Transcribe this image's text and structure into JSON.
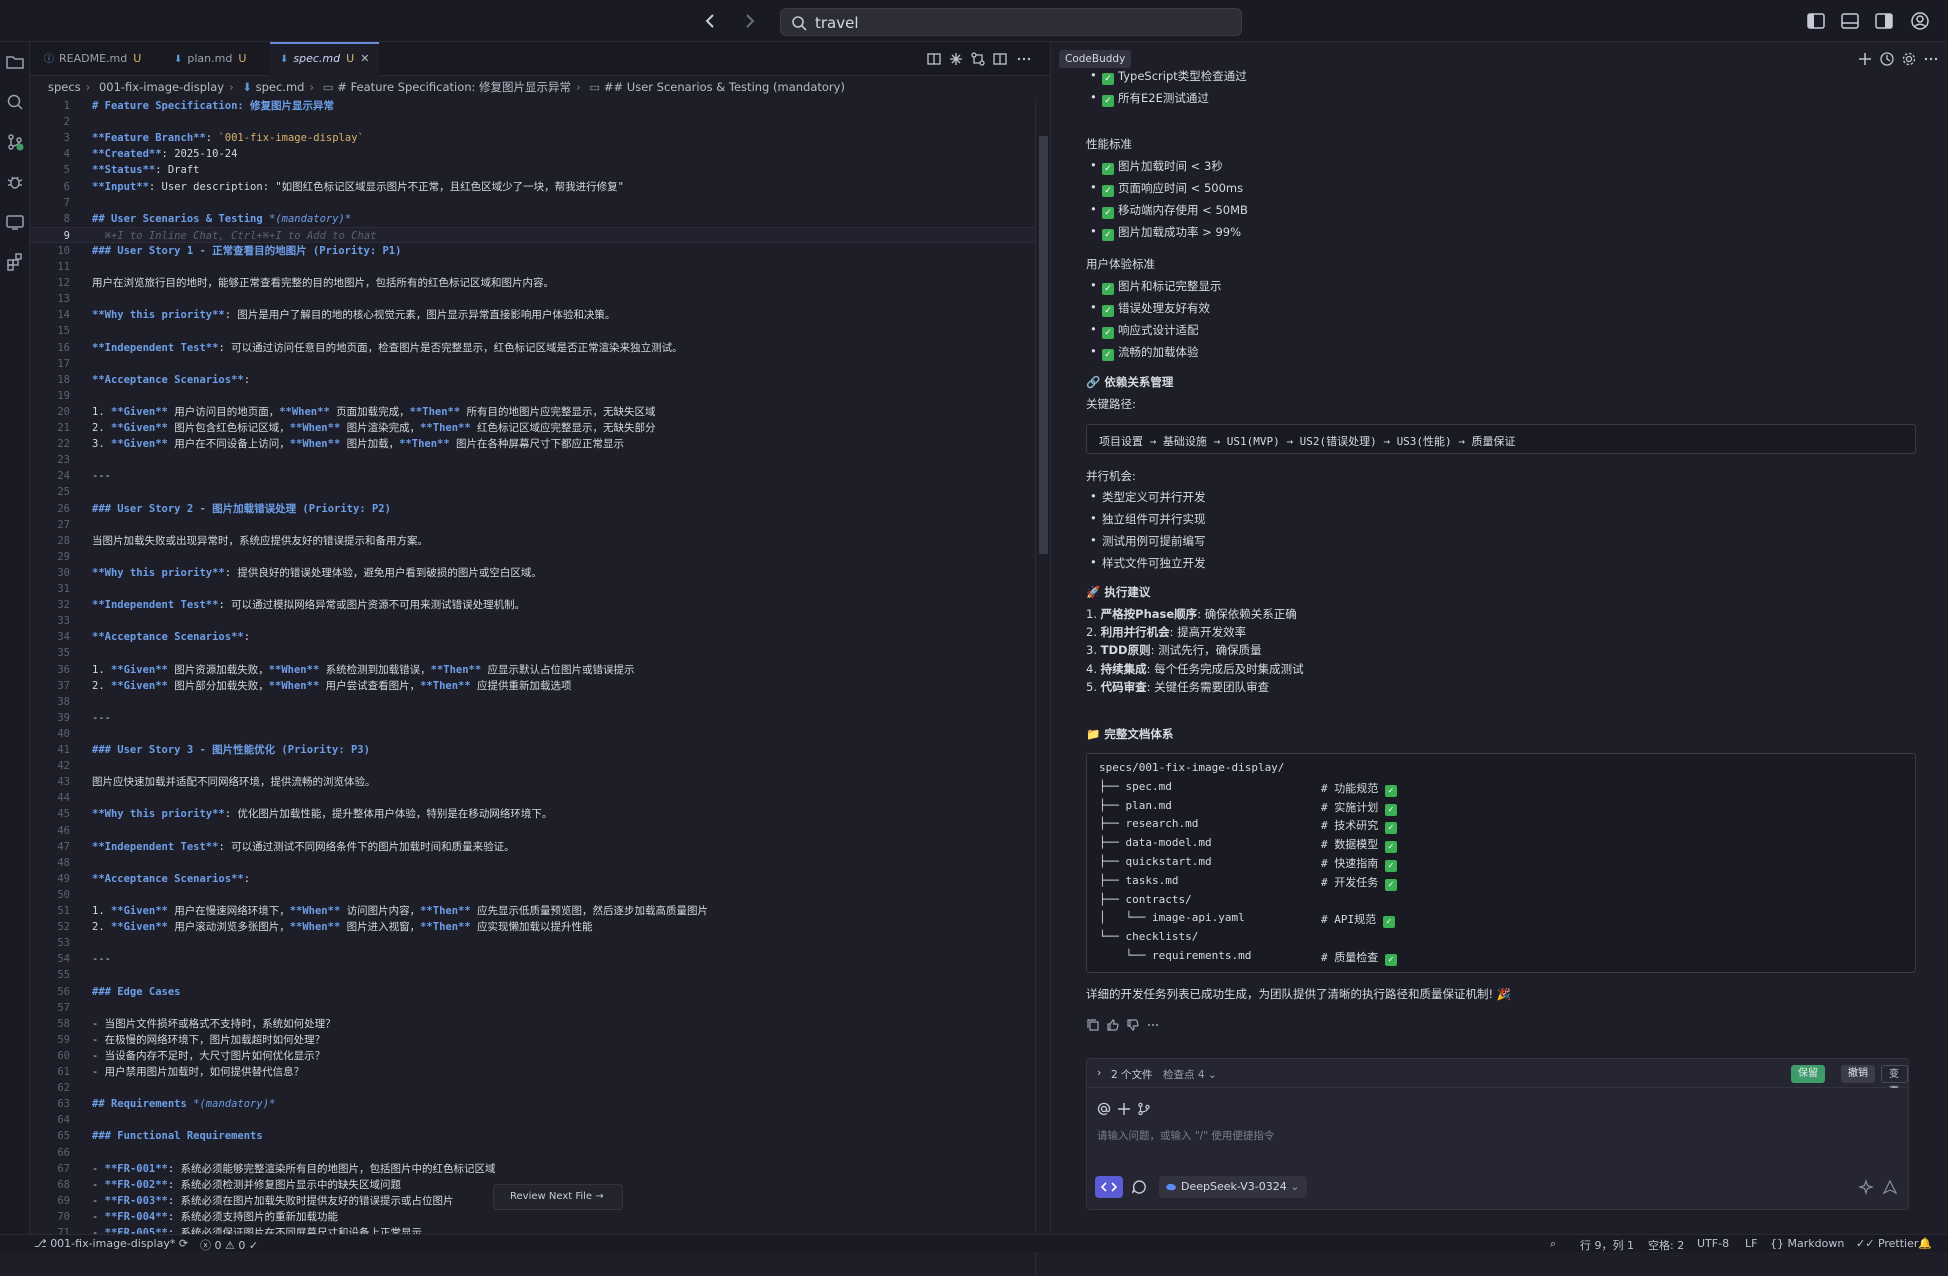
{
  "search": {
    "value": "travel"
  },
  "tabs": [
    {
      "label": "README.md",
      "status": "U"
    },
    {
      "label": "plan.md",
      "status": "U"
    },
    {
      "label": "spec.md",
      "status": "U"
    }
  ],
  "breadcrumb": [
    "specs",
    "001-fix-image-display",
    "spec.md",
    "# Feature Specification: 修复图片显示异常",
    "## User Scenarios & Testing (mandatory)"
  ],
  "editor": {
    "lines": [
      [
        {
          "t": "# Feature Specification: 修复图片显示异常",
          "c": "h"
        }
      ],
      [],
      [
        {
          "t": "**Feature Branch**",
          "c": "b"
        },
        {
          "t": ": "
        },
        {
          "t": "`001-fix-image-display`",
          "c": "str"
        }
      ],
      [
        {
          "t": "**Created**",
          "c": "b"
        },
        {
          "t": ": 2025-10-24"
        }
      ],
      [
        {
          "t": "**Status**",
          "c": "b"
        },
        {
          "t": ": Draft"
        }
      ],
      [
        {
          "t": "**Input**",
          "c": "b"
        },
        {
          "t": ": User description: \"如图红色标记区域显示图片不正常，且红色区域少了一块，帮我进行修复\""
        }
      ],
      [],
      [
        {
          "t": "## User Scenarios & Testing ",
          "c": "h"
        },
        {
          "t": "*(mandatory)*",
          "c": "it"
        }
      ],
      [
        {
          "t": "  ⌘+I to Inline Chat, Ctrl+⌘+I to Add to Chat",
          "c": "hint"
        }
      ],
      [
        {
          "t": "### User Story 1 - 正常查看目的地图片 (Priority: P1)",
          "c": "h"
        }
      ],
      [],
      [
        {
          "t": "用户在浏览旅行目的地时，能够正常查看完整的目的地图片，包括所有的红色标记区域和图片内容。"
        }
      ],
      [],
      [
        {
          "t": "**Why this priority**",
          "c": "b"
        },
        {
          "t": ": 图片是用户了解目的地的核心视觉元素，图片显示异常直接影响用户体验和决策。"
        }
      ],
      [],
      [
        {
          "t": "**Independent Test**",
          "c": "b"
        },
        {
          "t": ": 可以通过访问任意目的地页面，检查图片是否完整显示，红色标记区域是否正常渲染来独立测试。"
        }
      ],
      [],
      [
        {
          "t": "**Acceptance Scenarios**",
          "c": "b"
        },
        {
          "t": ":"
        }
      ],
      [],
      [
        {
          "t": "1. "
        },
        {
          "t": "**Given**",
          "c": "b"
        },
        {
          "t": " 用户访问目的地页面，"
        },
        {
          "t": "**When**",
          "c": "b"
        },
        {
          "t": " 页面加载完成，"
        },
        {
          "t": "**Then**",
          "c": "b"
        },
        {
          "t": " 所有目的地图片应完整显示，无缺失区域"
        }
      ],
      [
        {
          "t": "2. "
        },
        {
          "t": "**Given**",
          "c": "b"
        },
        {
          "t": " 图片包含红色标记区域，"
        },
        {
          "t": "**When**",
          "c": "b"
        },
        {
          "t": " 图片渲染完成，"
        },
        {
          "t": "**Then**",
          "c": "b"
        },
        {
          "t": " 红色标记区域应完整显示，无缺失部分"
        }
      ],
      [
        {
          "t": "3. "
        },
        {
          "t": "**Given**",
          "c": "b"
        },
        {
          "t": " 用户在不同设备上访问，"
        },
        {
          "t": "**When**",
          "c": "b"
        },
        {
          "t": " 图片加载，"
        },
        {
          "t": "**Then**",
          "c": "b"
        },
        {
          "t": " 图片在各种屏幕尺寸下都应正常显示"
        }
      ],
      [],
      [
        {
          "t": "---"
        }
      ],
      [],
      [
        {
          "t": "### User Story 2 - 图片加载错误处理 (Priority: P2)",
          "c": "h"
        }
      ],
      [],
      [
        {
          "t": "当图片加载失败或出现异常时，系统应提供友好的错误提示和备用方案。"
        }
      ],
      [],
      [
        {
          "t": "**Why this priority**",
          "c": "b"
        },
        {
          "t": ": 提供良好的错误处理体验，避免用户看到破损的图片或空白区域。"
        }
      ],
      [],
      [
        {
          "t": "**Independent Test**",
          "c": "b"
        },
        {
          "t": ": 可以通过模拟网络异常或图片资源不可用来测试错误处理机制。"
        }
      ],
      [],
      [
        {
          "t": "**Acceptance Scenarios**",
          "c": "b"
        },
        {
          "t": ":"
        }
      ],
      [],
      [
        {
          "t": "1. "
        },
        {
          "t": "**Given**",
          "c": "b"
        },
        {
          "t": " 图片资源加载失败，"
        },
        {
          "t": "**When**",
          "c": "b"
        },
        {
          "t": " 系统检测到加载错误，"
        },
        {
          "t": "**Then**",
          "c": "b"
        },
        {
          "t": " 应显示默认占位图片或错误提示"
        }
      ],
      [
        {
          "t": "2. "
        },
        {
          "t": "**Given**",
          "c": "b"
        },
        {
          "t": " 图片部分加载失败，"
        },
        {
          "t": "**When**",
          "c": "b"
        },
        {
          "t": " 用户尝试查看图片，"
        },
        {
          "t": "**Then**",
          "c": "b"
        },
        {
          "t": " 应提供重新加载选项"
        }
      ],
      [],
      [
        {
          "t": "---"
        }
      ],
      [],
      [
        {
          "t": "### User Story 3 - 图片性能优化 (Priority: P3)",
          "c": "h"
        }
      ],
      [],
      [
        {
          "t": "图片应快速加载并适配不同网络环境，提供流畅的浏览体验。"
        }
      ],
      [],
      [
        {
          "t": "**Why this priority**",
          "c": "b"
        },
        {
          "t": ": 优化图片加载性能，提升整体用户体验，特别是在移动网络环境下。"
        }
      ],
      [],
      [
        {
          "t": "**Independent Test**",
          "c": "b"
        },
        {
          "t": ": 可以通过测试不同网络条件下的图片加载时间和质量来验证。"
        }
      ],
      [],
      [
        {
          "t": "**Acceptance Scenarios**",
          "c": "b"
        },
        {
          "t": ":"
        }
      ],
      [],
      [
        {
          "t": "1. "
        },
        {
          "t": "**Given**",
          "c": "b"
        },
        {
          "t": " 用户在慢速网络环境下，"
        },
        {
          "t": "**When**",
          "c": "b"
        },
        {
          "t": " 访问图片内容，"
        },
        {
          "t": "**Then**",
          "c": "b"
        },
        {
          "t": " 应先显示低质量预览图，然后逐步加载高质量图片"
        }
      ],
      [
        {
          "t": "2. "
        },
        {
          "t": "**Given**",
          "c": "b"
        },
        {
          "t": " 用户滚动浏览多张图片，"
        },
        {
          "t": "**When**",
          "c": "b"
        },
        {
          "t": " 图片进入视窗，"
        },
        {
          "t": "**Then**",
          "c": "b"
        },
        {
          "t": " 应实现懒加载以提升性能"
        }
      ],
      [],
      [
        {
          "t": "---"
        }
      ],
      [],
      [
        {
          "t": "### Edge Cases",
          "c": "h"
        }
      ],
      [],
      [
        {
          "t": "- 当图片文件损坏或格式不支持时，系统如何处理？"
        }
      ],
      [
        {
          "t": "- 在极慢的网络环境下，图片加载超时如何处理？"
        }
      ],
      [
        {
          "t": "- 当设备内存不足时，大尺寸图片如何优化显示？"
        }
      ],
      [
        {
          "t": "- 用户禁用图片加载时，如何提供替代信息？"
        }
      ],
      [],
      [
        {
          "t": "## Requirements ",
          "c": "h"
        },
        {
          "t": "*(mandatory)*",
          "c": "it"
        }
      ],
      [],
      [
        {
          "t": "### Functional Requirements",
          "c": "h"
        }
      ],
      [],
      [
        {
          "t": "- "
        },
        {
          "t": "**FR-001**",
          "c": "b"
        },
        {
          "t": ": 系统必须能够完整渲染所有目的地图片，包括图片中的红色标记区域"
        }
      ],
      [
        {
          "t": "- "
        },
        {
          "t": "**FR-002**",
          "c": "b"
        },
        {
          "t": ": 系统必须检测并修复图片显示中的缺失区域问题"
        }
      ],
      [
        {
          "t": "- "
        },
        {
          "t": "**FR-003**",
          "c": "b"
        },
        {
          "t": ": 系统必须在图片加载失败时提供友好的错误提示或占位图片"
        }
      ],
      [
        {
          "t": "- "
        },
        {
          "t": "**FR-004**",
          "c": "b"
        },
        {
          "t": ": 系统必须支持图片的重新加载功能"
        }
      ],
      [
        {
          "t": "- "
        },
        {
          "t": "**FR-005**",
          "c": "b"
        },
        {
          "t": ": 系统必须保证图片在不同屏幕尺寸和设备上正常显示"
        }
      ]
    ],
    "current_line": 9,
    "review_label": "Review Next File"
  },
  "chat": {
    "badge": "CodeBuddy",
    "top_items": [
      "TypeScript类型检查通过",
      "所有E2E测试通过"
    ],
    "perf_title": "性能标准",
    "perf_items": [
      "图片加载时间 < 3秒",
      "页面响应时间 < 500ms",
      "移动端内存使用 < 50MB",
      "图片加载成功率 > 99%"
    ],
    "ux_title": "用户体验标准",
    "ux_items": [
      "图片和标记完整显示",
      "错误处理友好有效",
      "响应式设计适配",
      "流畅的加载体验"
    ],
    "dep_title": "🔗 依赖关系管理",
    "key_path_label": "关键路径:",
    "key_path": "项目设置 → 基础设施 → US1(MVP) → US2(错误处理) → US3(性能) → 质量保证",
    "parallel_label": "并行机会:",
    "parallel_items": [
      "类型定义可并行开发",
      "独立组件可并行实现",
      "测试用例可提前编写",
      "样式文件可独立开发"
    ],
    "exec_title": "🚀 执行建议",
    "exec_items": [
      {
        "n": "1.",
        "b": "严格按Phase顺序",
        "t": ": 确保依赖关系正确"
      },
      {
        "n": "2.",
        "b": "利用并行机会",
        "t": ": 提高开发效率"
      },
      {
        "n": "3.",
        "b": "TDD原则",
        "t": ": 测试先行，确保质量"
      },
      {
        "n": "4.",
        "b": "持续集成",
        "t": ": 每个任务完成后及时集成测试"
      },
      {
        "n": "5.",
        "b": "代码审查",
        "t": ": 关键任务需要团队审查"
      }
    ],
    "docs_title": "📁 完整文档体系",
    "tree": [
      {
        "p": "specs/001-fix-image-display/",
        "c": ""
      },
      {
        "p": "├── spec.md",
        "c": "# 功能规范"
      },
      {
        "p": "├── plan.md",
        "c": "# 实施计划"
      },
      {
        "p": "├── research.md",
        "c": "# 技术研究"
      },
      {
        "p": "├── data-model.md",
        "c": "# 数据模型"
      },
      {
        "p": "├── quickstart.md",
        "c": "# 快速指南"
      },
      {
        "p": "├── tasks.md",
        "c": "# 开发任务"
      },
      {
        "p": "├── contracts/",
        "c": ""
      },
      {
        "p": "│   └── image-api.yaml",
        "c": "# API规范"
      },
      {
        "p": "└── checklists/",
        "c": ""
      },
      {
        "p": "    └── requirements.md",
        "c": "# 质量检查"
      }
    ],
    "summary": "详细的开发任务列表已成功生成，为团队提供了清晰的执行路径和质量保证机制! 🎉",
    "files_label": "2 个文件",
    "checkpoint": "检查点 4",
    "keep": "保留",
    "undo": "撤销",
    "changes": "变更",
    "input_placeholder": "请输入问题，或输入 \"/\" 使用便捷指令",
    "model": "DeepSeek-V3-0324"
  },
  "status": {
    "branch": "001-fix-image-display*",
    "errors": "0",
    "warnings": "0",
    "position": "行 9，列 1",
    "spaces": "空格: 2",
    "encoding": "UTF-8",
    "eol": "LF",
    "language": "Markdown",
    "formatter": "Prettier"
  },
  "colors": {
    "accent": "#6d9ee8",
    "keep": "#3e9c6a",
    "mode": "#5b5bd6",
    "check": "#3cb054"
  }
}
